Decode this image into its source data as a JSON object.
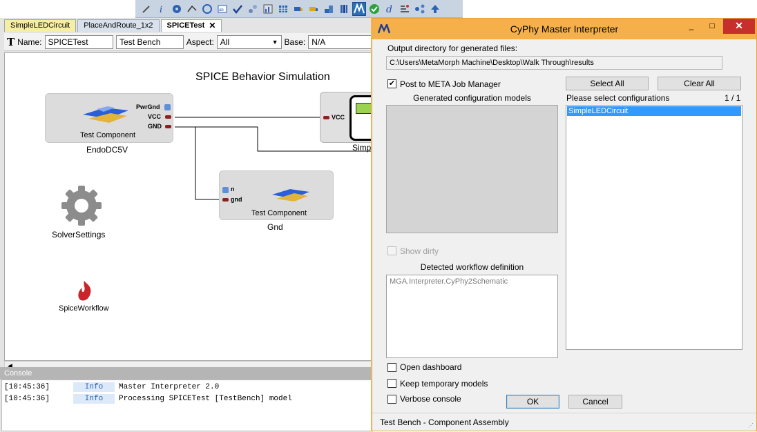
{
  "toolbar": {
    "icons": [
      "pencil-icon",
      "info-icon",
      "gear-icon",
      "connect-icon",
      "settings-icon",
      "table-icon",
      "check-icon",
      "cluster-icon",
      "chart-icon",
      "grid-icon",
      "truck-icon",
      "truck2-icon",
      "blocks-icon",
      "books-icon",
      "meta-icon",
      "green-check-icon",
      "d-icon",
      "tools-icon",
      "network-icon",
      "arrow-up-icon"
    ]
  },
  "editor": {
    "tabs": [
      {
        "label": "SimpleLEDCircuit"
      },
      {
        "label": "PlaceAndRoute_1x2"
      },
      {
        "label": "SPICETest",
        "close": "✕"
      }
    ],
    "props": {
      "name_label": "Name:",
      "name_value": "SPICETest",
      "kind_value": "Test Bench",
      "aspect_label": "Aspect:",
      "aspect_value": "All",
      "base_label": "Base:",
      "base_value": "N/A"
    },
    "canvas": {
      "title": "SPICE Behavior Simulation",
      "endo": {
        "inner": "Test Component",
        "name": "EndoDC5V",
        "ports": [
          "PwrGnd",
          "VCC",
          "GND"
        ]
      },
      "gnd": {
        "inner": "Test Component",
        "name": "Gnd",
        "ports": [
          "n",
          "gnd"
        ]
      },
      "simp": {
        "port": "VCC",
        "name": "Simp"
      },
      "solver": {
        "name": "SolverSettings"
      },
      "workflow": {
        "name": "SpiceWorkflow"
      }
    }
  },
  "console": {
    "header": "Console",
    "rows": [
      {
        "time": "[10:45:36]",
        "level": "Info",
        "message": "Master Interpreter 2.0"
      },
      {
        "time": "[10:45:36]",
        "level": "Info",
        "message": "Processing SPICETest [TestBench] model"
      }
    ]
  },
  "dialog": {
    "title": "CyPhy Master Interpreter",
    "window_buttons": {
      "minimize": "_",
      "maximize": "□",
      "close": "✕"
    },
    "output_dir_label": "Output directory for generated files:",
    "output_dir_value": "C:\\Users\\MetaMorph Machine\\Desktop\\Walk Through\\results",
    "post_to_job_manager": {
      "label": "Post to META Job Manager",
      "checked": true
    },
    "select_all": "Select All",
    "clear_all": "Clear All",
    "generated_models_label": "Generated configuration models",
    "please_select_label": "Please select configurations",
    "selection_count": "1 / 1",
    "configurations": [
      "SimpleLEDCircuit"
    ],
    "show_dirty": {
      "label": "Show dirty",
      "checked": false,
      "disabled": true
    },
    "workflow_label": "Detected workflow definition",
    "workflow_value": "MGA.Interpreter.CyPhy2Schematic",
    "open_dashboard": {
      "label": "Open dashboard",
      "checked": false
    },
    "keep_temp": {
      "label": "Keep temporary models",
      "checked": false
    },
    "verbose": {
      "label": "Verbose console",
      "checked": false
    },
    "ok": "OK",
    "cancel": "Cancel",
    "status": "Test Bench - Component Assembly"
  }
}
